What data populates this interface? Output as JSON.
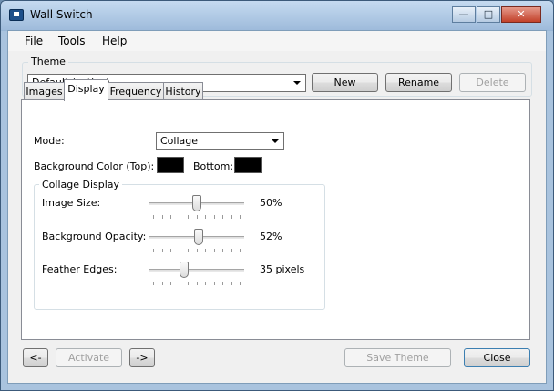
{
  "window": {
    "title": "Wall Switch",
    "minimize_glyph": "—",
    "maximize_glyph": "□",
    "close_glyph": "✕"
  },
  "menu": [
    "File",
    "Tools",
    "Help"
  ],
  "theme": {
    "label": "Theme",
    "selected": "Default (active)",
    "new_label": "New",
    "rename_label": "Rename",
    "delete_label": "Delete"
  },
  "tabs": [
    {
      "label": "Images",
      "active": false
    },
    {
      "label": "Display",
      "active": true
    },
    {
      "label": "Frequency",
      "active": false
    },
    {
      "label": "History",
      "active": false
    }
  ],
  "display": {
    "mode_label": "Mode:",
    "mode_value": "Collage",
    "bg_top_label": "Background Color (Top):",
    "bg_bottom_label": "Bottom:",
    "bg_top_color": "#000000",
    "bg_bottom_color": "#000000",
    "collage": {
      "label": "Collage Display",
      "sliders": [
        {
          "label": "Image Size:",
          "value_text": "50%",
          "fraction": 0.5
        },
        {
          "label": "Background Opacity:",
          "value_text": "52%",
          "fraction": 0.52
        },
        {
          "label": "Feather Edges:",
          "value_text": "35 pixels",
          "fraction": 0.35
        }
      ]
    }
  },
  "footer": {
    "prev_label": "<-",
    "activate_label": "Activate",
    "next_label": "->",
    "save_label": "Save Theme",
    "close_label": "Close"
  }
}
